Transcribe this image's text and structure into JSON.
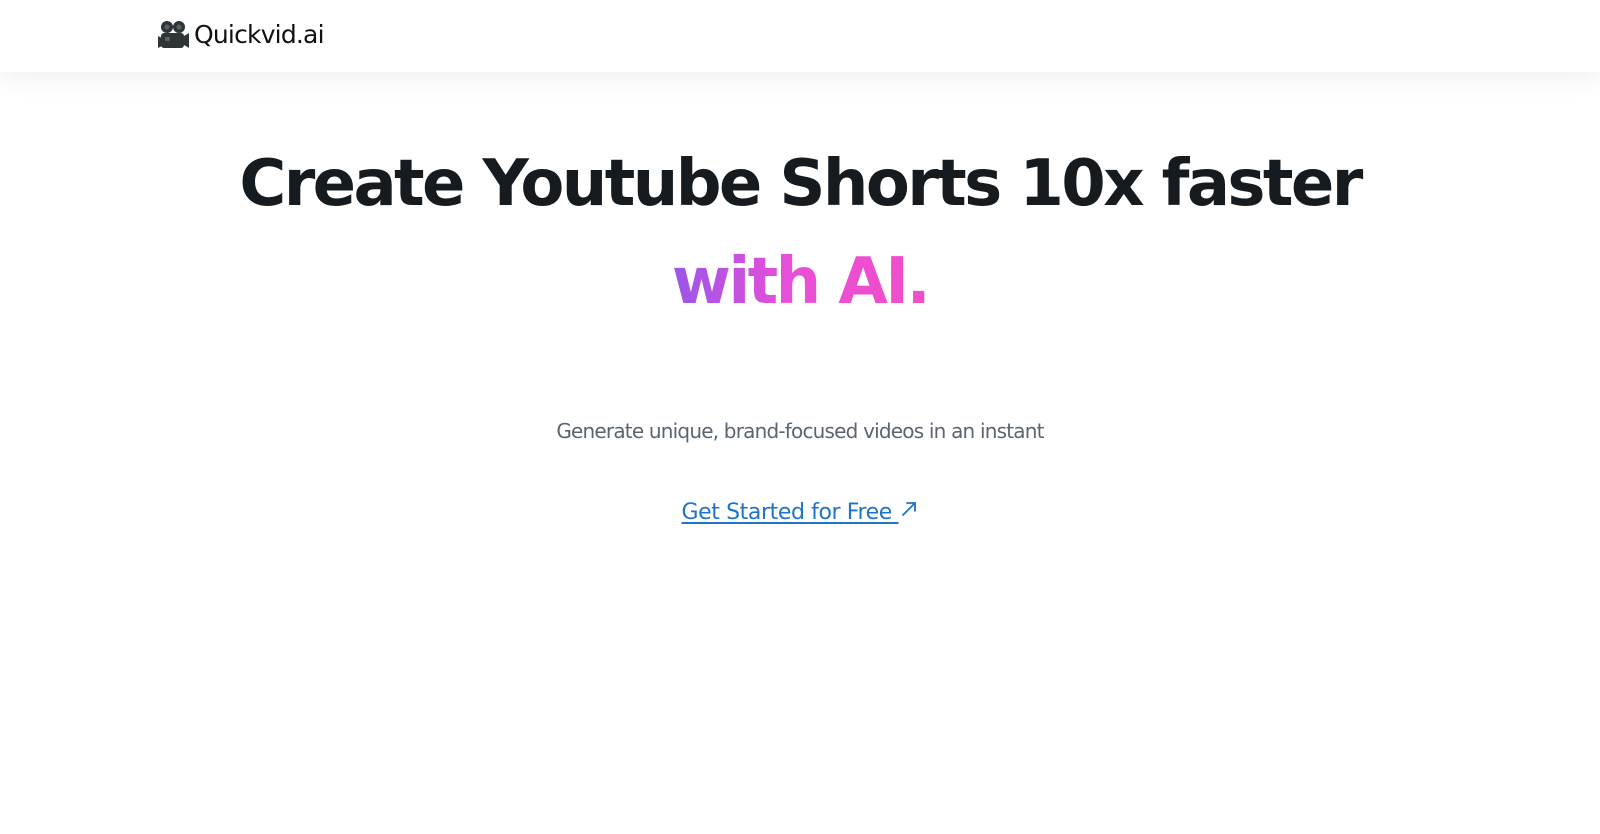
{
  "navbar": {
    "brand_name": "Quickvid.ai",
    "brand_icon": "movie-camera-icon"
  },
  "hero": {
    "headline": "Create Youtube Shorts 10x faster",
    "headline_accent": "with AI.",
    "subtitle": "Generate unique, brand-focused videos in an instant",
    "cta_label": "Get Started for Free",
    "cta_icon": "external-arrow-icon"
  },
  "colors": {
    "headline": "#161b1f",
    "accent_gradient_start": "#9b55e8",
    "accent_gradient_end": "#f24ec8",
    "subtitle": "#5b6472",
    "link": "#1f74c7"
  }
}
